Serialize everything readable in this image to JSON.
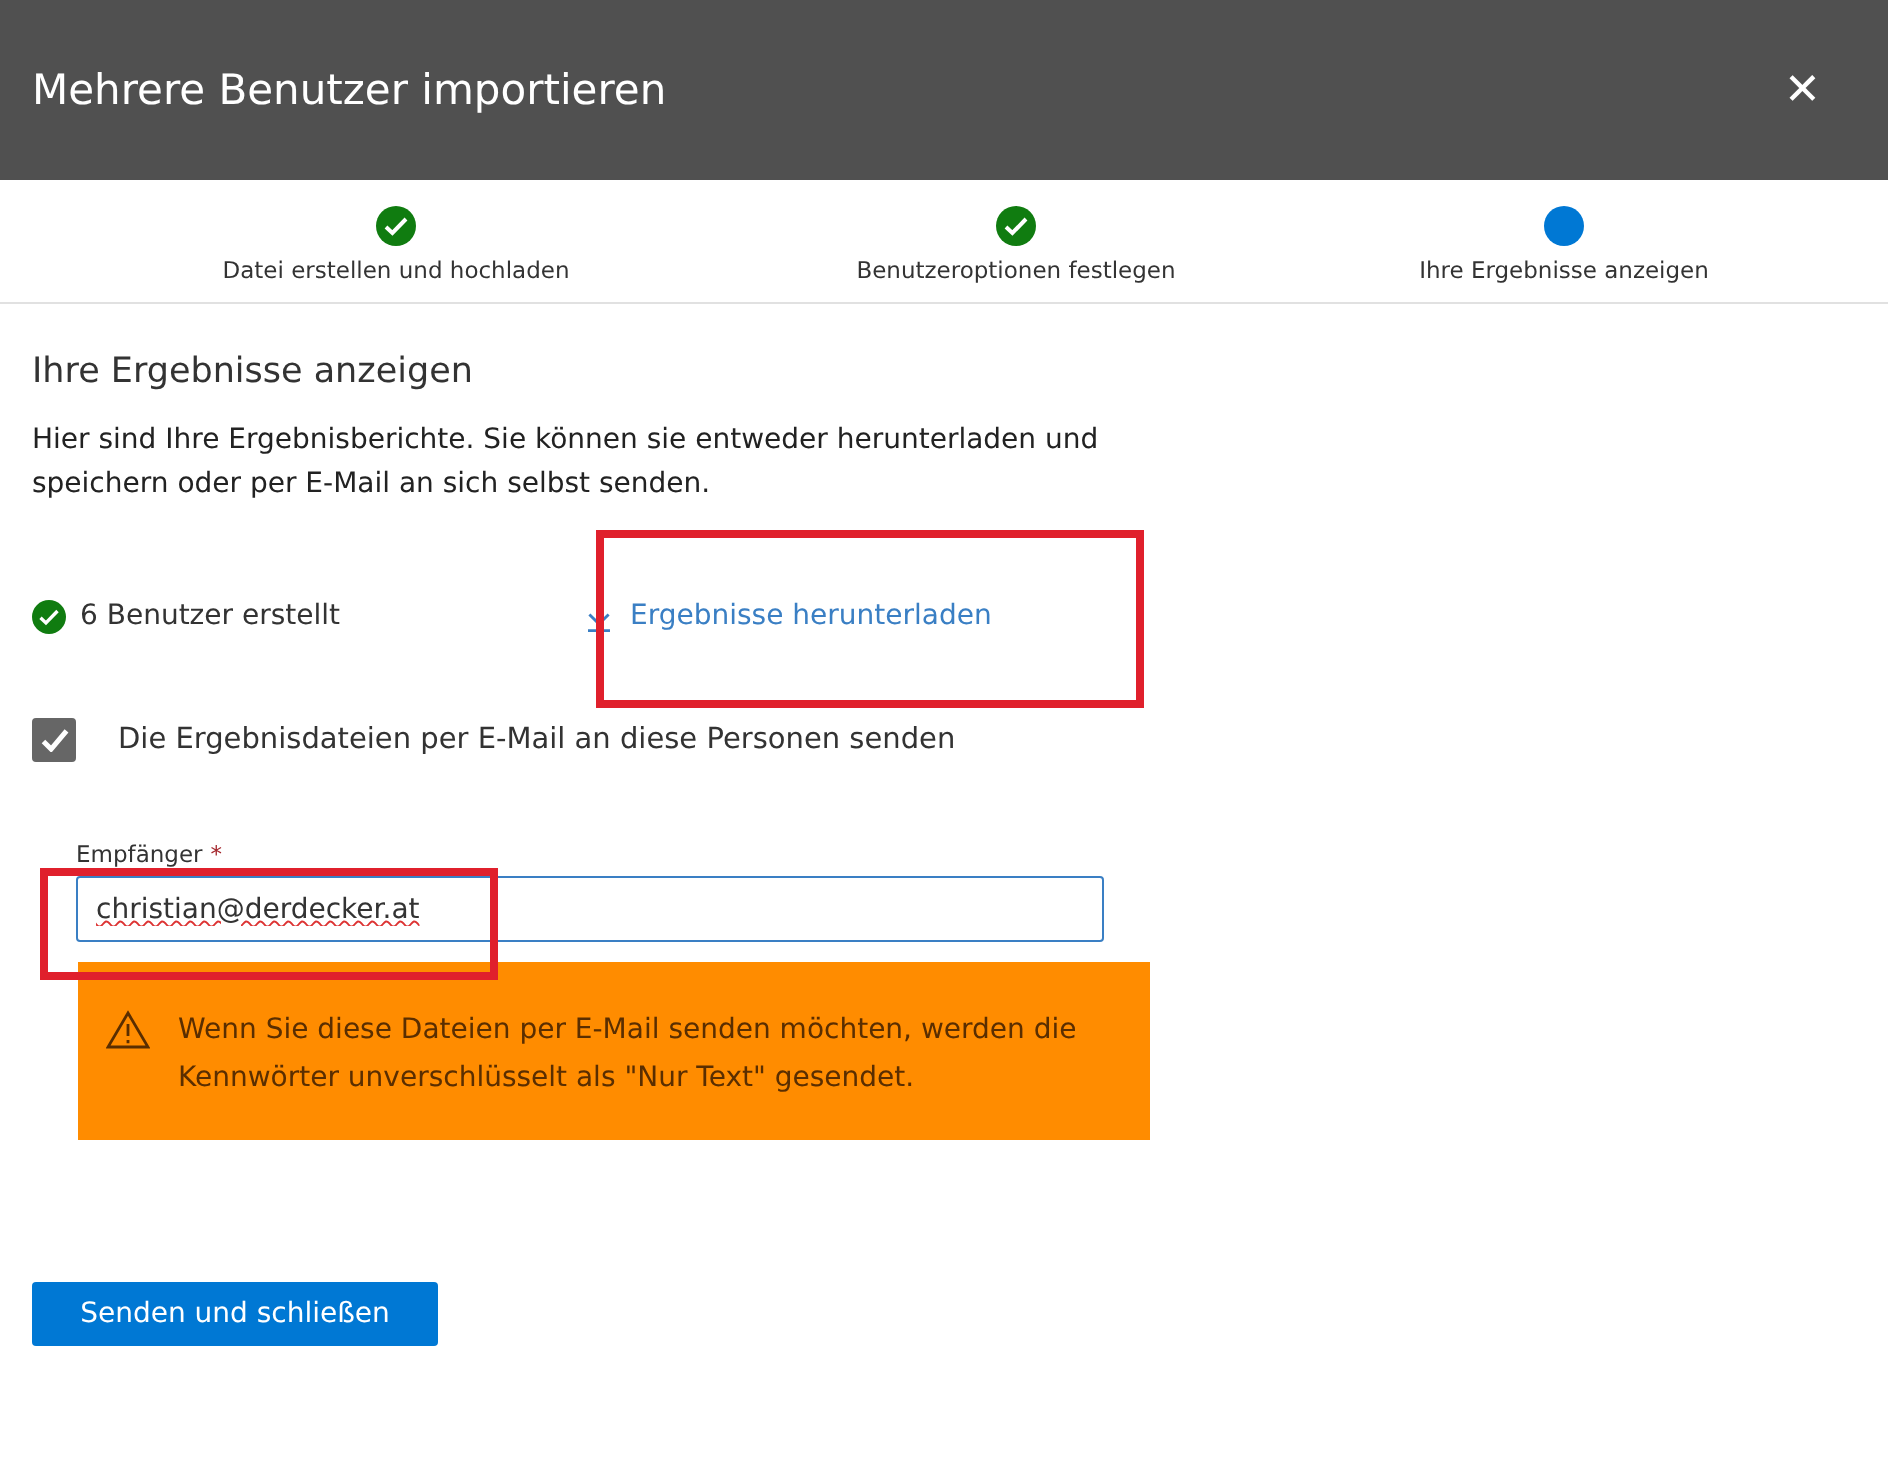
{
  "window": {
    "title": "Mehrere Benutzer importieren",
    "close": "✕"
  },
  "steps": [
    {
      "label": "Datei erstellen und hochladen",
      "done": true
    },
    {
      "label": "Benutzeroptionen festlegen",
      "done": true
    },
    {
      "label": "Ihre Ergebnisse anzeigen",
      "done": false
    }
  ],
  "heading": "Ihre Ergebnisse anzeigen",
  "description": "Hier sind Ihre Ergebnisberichte. Sie können sie entweder herunterladen und speichern oder per E-Mail an sich selbst senden.",
  "status": "6 Benutzer erstellt",
  "download_link": {
    "label": "Ergebnisse herunterladen",
    "highlighted": true
  },
  "email_checkbox": {
    "label": "Die Ergebnisdateien per E-Mail an diese Personen senden",
    "checked": true
  },
  "recipient_field": {
    "label": "Empfänger",
    "required_mark": "*",
    "value": "christian@derdecker.at",
    "highlighted": true
  },
  "warning": "Wenn Sie diese Dateien per E-Mail senden möchten, werden die Kennwörter unverschlüsselt als \"Nur Text\" gesendet.",
  "primary_button": "Senden und schließen"
}
